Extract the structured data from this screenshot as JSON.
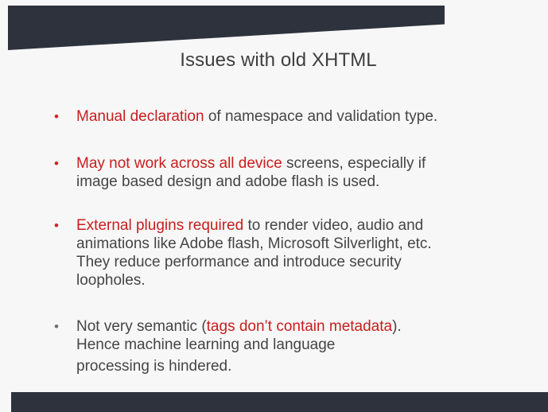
{
  "slide": {
    "title": "Issues with old XHTML",
    "bullets": [
      {
        "highlight": "Manual declaration",
        "rest": " of namespace and validation type."
      },
      {
        "highlight": "May not work across all device",
        "line1_rest": " screens, especially if",
        "line2": "image based design and adobe flash is used."
      },
      {
        "highlight": "External plugins required",
        "line1_rest": " to render video,  audio and",
        "line2": "animations like Adobe flash, Microsoft Silverlight, etc.",
        "line3": "They reduce performance and introduce security",
        "line4": "loopholes."
      },
      {
        "prefix": "Not very semantic (",
        "highlight": "tags don’t contain metadata",
        "suffix": ").",
        "line2": "Hence machine learning and language",
        "line3": "processing is hindered."
      }
    ],
    "bullet_symbol": "•",
    "colors": {
      "highlight": "#c91d1d",
      "bar": "#2d323d",
      "text": "#454545"
    }
  }
}
